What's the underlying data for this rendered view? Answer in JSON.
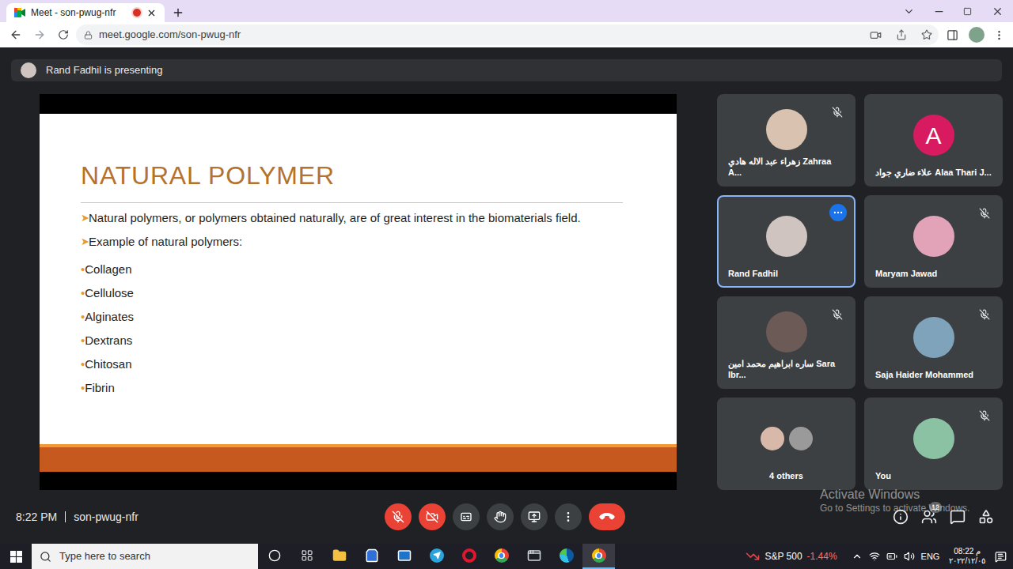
{
  "browser": {
    "tab": {
      "title": "Meet - son-pwug-nfr",
      "recording": true
    },
    "url": "meet.google.com/son-pwug-nfr"
  },
  "meet": {
    "presenting": "Rand Fadhil is presenting",
    "slide": {
      "title": "NATURAL POLYMER",
      "bullet_glyph": "➤",
      "bullets": [
        "Natural polymers, or polymers obtained naturally, are of great interest in the biomaterials field.",
        "Example of natural polymers:"
      ],
      "item_glyph": "•",
      "items": [
        "Collagen",
        "Cellulose",
        "Alginates",
        "Dextrans",
        "Chitosan",
        "Fibrin"
      ]
    },
    "participants": [
      {
        "name": "زهراء عبد الاله هادي Zahraa A...",
        "muted": true,
        "selected": false,
        "avatar": {
          "kind": "photo",
          "color": "#d9c2b0"
        }
      },
      {
        "name": "علاء ضاري جواد Alaa Thari J...",
        "muted": false,
        "selected": false,
        "avatar": {
          "kind": "letter",
          "letter": "A",
          "color": "#d81b60"
        }
      },
      {
        "name": "Rand Fadhil",
        "muted": false,
        "selected": true,
        "avatar": {
          "kind": "photo",
          "color": "#cfc4c0"
        }
      },
      {
        "name": "Maryam Jawad",
        "muted": true,
        "selected": false,
        "avatar": {
          "kind": "photo",
          "color": "#e2a3b9"
        }
      },
      {
        "name": "ساره ابراهيم محمد امين Sara Ibr...",
        "muted": true,
        "selected": false,
        "avatar": {
          "kind": "photo",
          "color": "#6b5a55"
        }
      },
      {
        "name": "Saja Haider Mohammed",
        "muted": true,
        "selected": false,
        "avatar": {
          "kind": "photo",
          "color": "#7fa3bb"
        }
      },
      {
        "name": "4 others",
        "muted": false,
        "selected": false,
        "avatar": {
          "kind": "group",
          "colors": [
            "#d8b8a8",
            "#9a9a9a"
          ]
        }
      },
      {
        "name": "You",
        "muted": true,
        "selected": false,
        "avatar": {
          "kind": "photo",
          "color": "#8cc2a4"
        }
      }
    ],
    "footer": {
      "time": "8:22 PM",
      "code": "son-pwug-nfr",
      "mic_on": false,
      "camera_on": false,
      "people_count": "12"
    }
  },
  "watermark": {
    "title": "Activate Windows",
    "subtitle": "Go to Settings to activate Windows."
  },
  "taskbar": {
    "search_placeholder": "Type here to search",
    "apps": [
      {
        "kind": "cortana",
        "active": false
      },
      {
        "kind": "taskview",
        "active": false
      },
      {
        "kind": "explorer",
        "active": false
      },
      {
        "kind": "store",
        "active": false
      },
      {
        "kind": "mail",
        "active": false
      },
      {
        "kind": "telegram",
        "active": false
      },
      {
        "kind": "opera",
        "active": false
      },
      {
        "kind": "chrome",
        "active": false
      },
      {
        "kind": "app",
        "active": false
      },
      {
        "kind": "edge",
        "active": false
      },
      {
        "kind": "chrome",
        "active": true
      }
    ],
    "stock": {
      "name": "S&P 500",
      "change": "-1.44%"
    },
    "language": "ENG",
    "time": "08:22 م",
    "date": "٢٠٢٢/١٢/٠٥"
  }
}
